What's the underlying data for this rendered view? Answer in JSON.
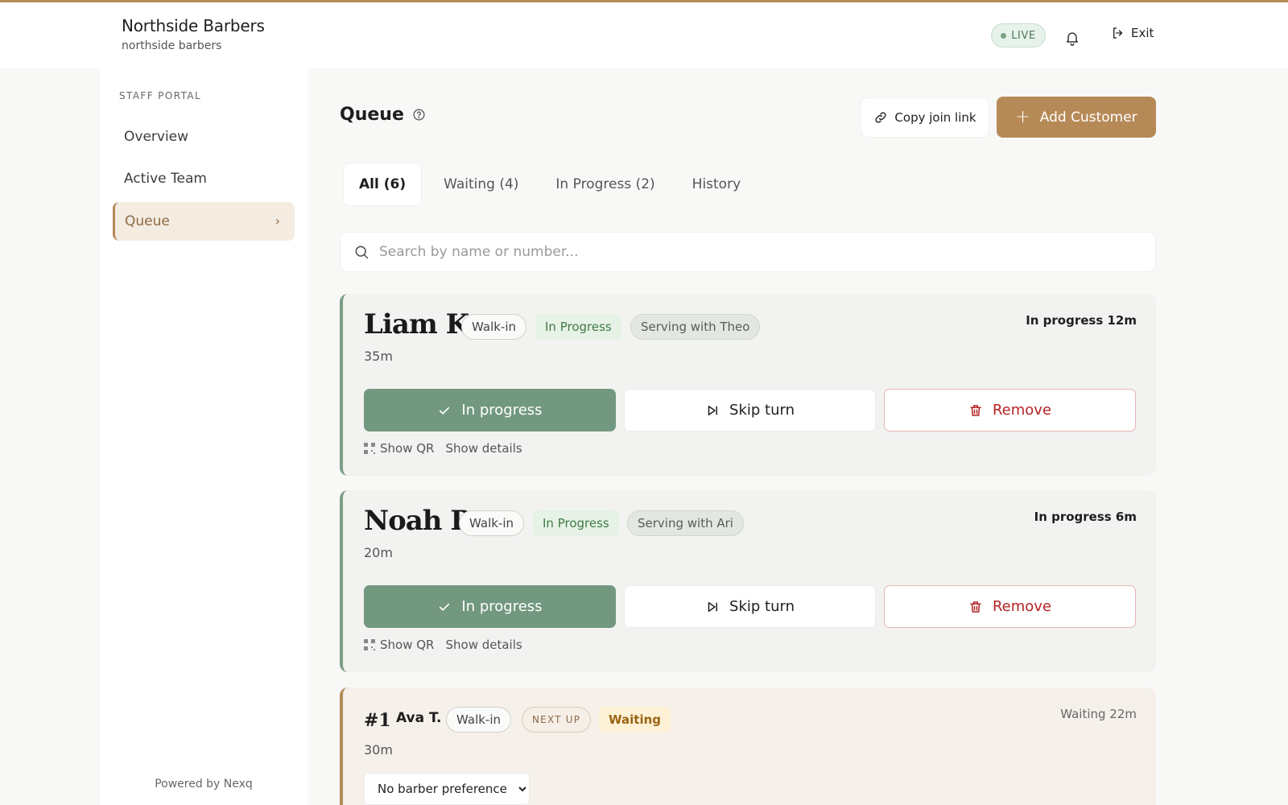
{
  "header": {
    "title": "Northside Barbers",
    "subtitle": "northside barbers",
    "live_label": "LIVE",
    "exit_label": "Exit"
  },
  "sidebar": {
    "section_label": "STAFF PORTAL",
    "items": [
      {
        "label": "Overview",
        "active": false
      },
      {
        "label": "Active Team",
        "active": false
      },
      {
        "label": "Queue",
        "active": true
      }
    ],
    "footer": "Powered by Nexq"
  },
  "main": {
    "title": "Queue",
    "copy_link_label": "Copy join link",
    "add_customer_label": "Add Customer",
    "tabs": [
      {
        "label": "All (6)",
        "active": true
      },
      {
        "label": "Waiting (4)",
        "active": false
      },
      {
        "label": "In Progress (2)",
        "active": false
      },
      {
        "label": "History",
        "active": false
      }
    ],
    "search_placeholder": "Search by name or number..."
  },
  "cards": [
    {
      "name": "Liam K.",
      "type": "Walk-in",
      "status": "In Progress",
      "serving": "Serving with Theo",
      "duration": "35m",
      "elapsed": "In progress 12m",
      "primary_action": "In progress",
      "skip_label": "Skip turn",
      "remove_label": "Remove",
      "qr_label": "Show QR",
      "details_label": "Show details"
    },
    {
      "name": "Noah P.",
      "type": "Walk-in",
      "status": "In Progress",
      "serving": "Serving with Ari",
      "duration": "20m",
      "elapsed": "In progress 6m",
      "primary_action": "In progress",
      "skip_label": "Skip turn",
      "remove_label": "Remove",
      "qr_label": "Show QR",
      "details_label": "Show details"
    },
    {
      "position": "#1",
      "name": "Ava T.",
      "type": "Walk-in",
      "tag": "NEXT UP",
      "status": "Waiting",
      "duration": "30m",
      "elapsed": "Waiting 22m",
      "barber_preference": "No barber preference"
    }
  ],
  "colors": {
    "accent": "#b68a57",
    "progress_green": "#729880",
    "remove_red": "#b42323"
  }
}
